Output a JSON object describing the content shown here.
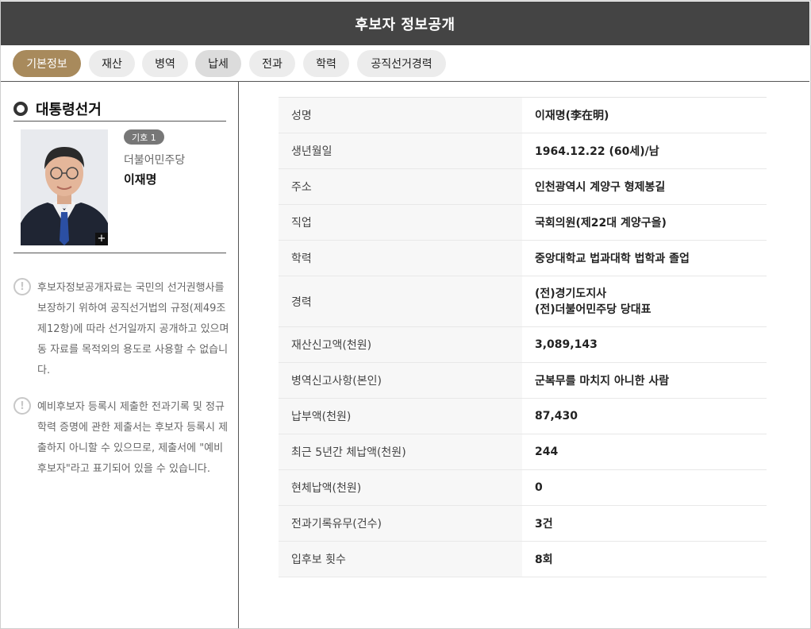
{
  "header": {
    "title": "후보자 정보공개"
  },
  "tabs": [
    {
      "label": "기본정보"
    },
    {
      "label": "재산"
    },
    {
      "label": "병역"
    },
    {
      "label": "납세"
    },
    {
      "label": "전과"
    },
    {
      "label": "학력"
    },
    {
      "label": "공직선거경력"
    }
  ],
  "sidebar": {
    "section_title": "대통령선거",
    "badge": "기호 1",
    "party": "더불어민주당",
    "name": "이재명",
    "zoom_icon": "+",
    "notice_icon": "!",
    "notices": [
      "후보자정보공개자료는 국민의 선거권행사를 보장하기 위하여 공직선거법의 규정(제49조 제12항)에 따라 선거일까지 공개하고 있으며 동 자료를 목적외의 용도로 사용할 수 없습니다.",
      "예비후보자 등록시 제출한 전과기록 및 정규학력 증명에 관한 제출서는 후보자 등록시 제출하지 아니할 수 있으므로, 제출서에 \"예비후보자\"라고 표기되어 있을 수 있습니다."
    ]
  },
  "info": {
    "rows": [
      {
        "label": "성명",
        "value": "이재명(李在明)"
      },
      {
        "label": "생년월일",
        "value": "1964.12.22 (60세)/남"
      },
      {
        "label": "주소",
        "value": "인천광역시 계양구 형제봉길"
      },
      {
        "label": "직업",
        "value": "국회의원(제22대 계양구을)"
      },
      {
        "label": "학력",
        "value": "중앙대학교 법과대학 법학과 졸업"
      },
      {
        "label": "경력",
        "lines": [
          "(전)경기도지사",
          "(전)더불어민주당 당대표"
        ]
      },
      {
        "label": "재산신고액(천원)",
        "value": "3,089,143"
      },
      {
        "label": "병역신고사항(본인)",
        "value": "군복무를 마치지 아니한 사람"
      },
      {
        "label": "납부액(천원)",
        "value": "87,430"
      },
      {
        "label": "최근 5년간 체납액(천원)",
        "value": "244"
      },
      {
        "label": "현체납액(천원)",
        "value": "0"
      },
      {
        "label": "전과기록유무(건수)",
        "value": "3건"
      },
      {
        "label": "입후보 횟수",
        "value": "8회"
      }
    ]
  },
  "colors": {
    "title_bar": "#444444",
    "active_tab": "#a88a5c",
    "tab": "#ececec"
  }
}
